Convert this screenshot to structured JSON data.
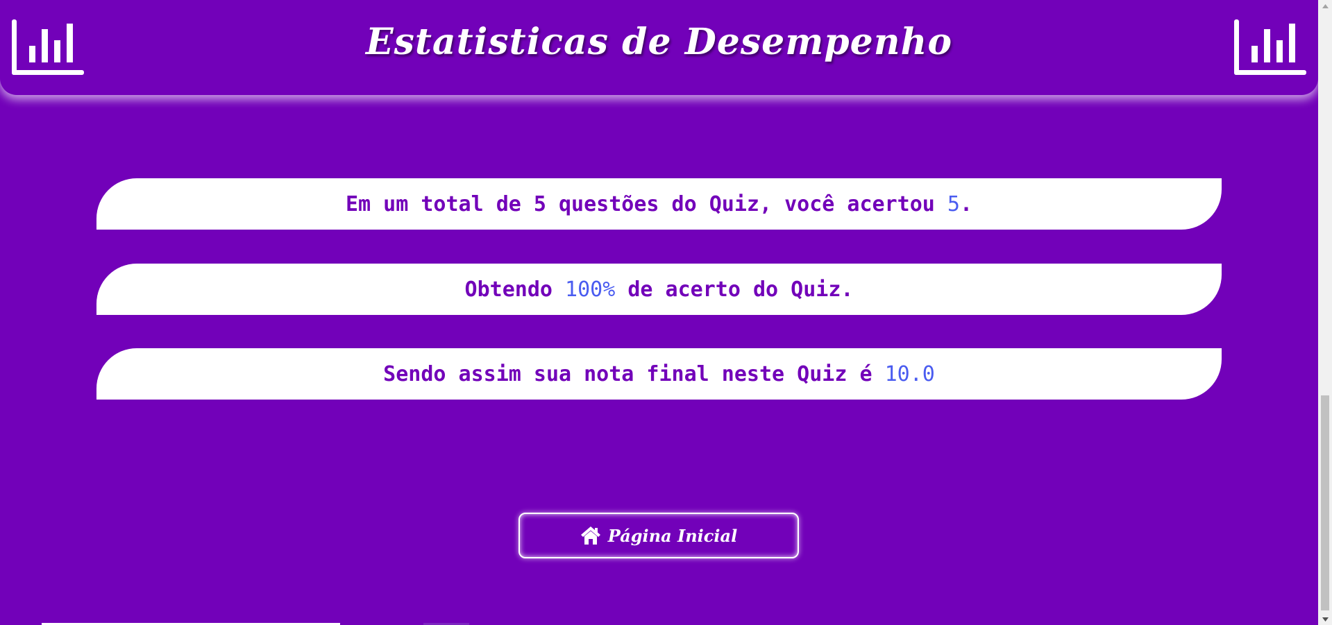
{
  "header": {
    "title": "Estatisticas de Desempenho",
    "left_icon": "bar-chart-icon",
    "right_icon": "bar-chart-icon"
  },
  "stats": {
    "line1": {
      "prefix": "Em um total de 5 questões do Quiz, você acertou ",
      "value": "5",
      "suffix": "."
    },
    "line2": {
      "prefix": "Obtendo ",
      "value": "100%",
      "suffix": " de acerto do Quiz."
    },
    "line3": {
      "prefix": "Sendo assim sua nota final neste Quiz é ",
      "value": "10.0",
      "suffix": ""
    }
  },
  "home_button": {
    "label": "Página Inicial",
    "icon": "home-icon"
  },
  "colors": {
    "background": "#7201b9",
    "card": "#ffffff",
    "card_text": "#7201b9",
    "highlight": "#4a5cf0"
  }
}
